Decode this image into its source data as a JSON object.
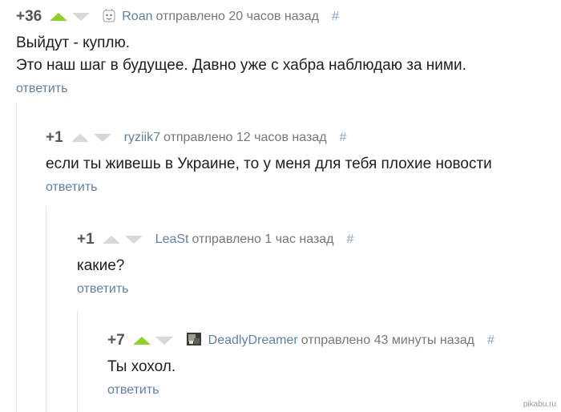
{
  "comments": [
    {
      "score": "+36",
      "author": "Roan",
      "meta": "отправлено 20 часов назад",
      "hash": "#",
      "lines": [
        "Выйдут - куплю.",
        "Это наш шаг в будущее. Давно уже с хабра наблюдаю за ними."
      ],
      "reply": "ответить",
      "upvoted": true
    },
    {
      "score": "+1",
      "author": "ryziik7",
      "meta": "отправлено 12 часов назад",
      "hash": "#",
      "lines": [
        "если ты живешь в Украине, то у меня для тебя плохие новости"
      ],
      "reply": "ответить",
      "upvoted": false
    },
    {
      "score": "+1",
      "author": "LeaSt",
      "meta": "отправлено 1 час назад",
      "hash": "#",
      "lines": [
        "какие?"
      ],
      "reply": "ответить",
      "upvoted": false
    },
    {
      "score": "+7",
      "author": "DeadlyDreamer",
      "meta": "отправлено 43 минуты назад",
      "hash": "#",
      "lines": [
        "Ты хохол."
      ],
      "reply": "ответить",
      "upvoted": true
    }
  ],
  "watermark": "pikabu.ru",
  "colors": {
    "upvote": "#8fd32a",
    "link": "#5e7fa8",
    "muted_arrow": "#d8d8d8"
  }
}
